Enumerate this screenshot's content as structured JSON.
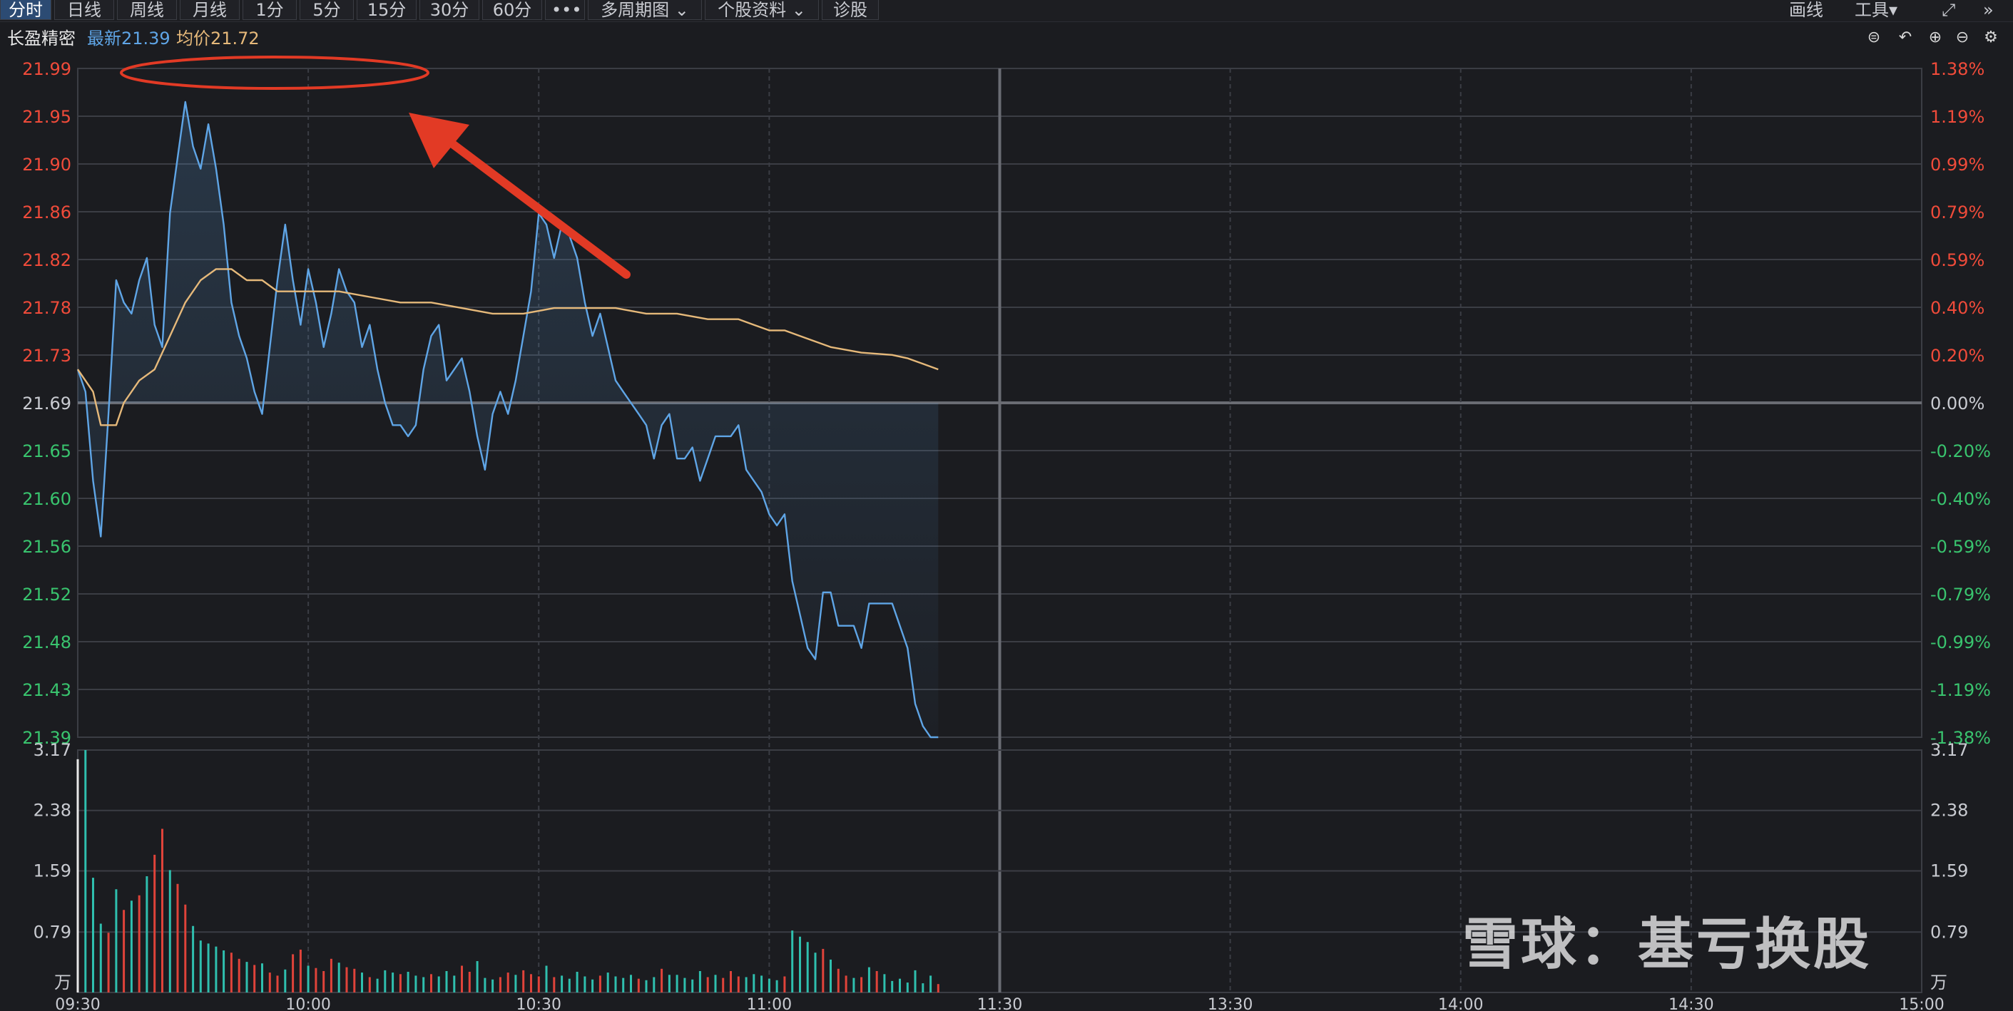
{
  "toolbar": {
    "tabs": [
      {
        "label": "分时",
        "active": true
      },
      {
        "label": "日线"
      },
      {
        "label": "周线"
      },
      {
        "label": "月线"
      },
      {
        "label": "1分"
      },
      {
        "label": "5分"
      },
      {
        "label": "15分"
      },
      {
        "label": "30分"
      },
      {
        "label": "60分"
      },
      {
        "label": "•••"
      },
      {
        "label": "多周期图 ⌄"
      },
      {
        "label": "个股资料 ⌄"
      },
      {
        "label": "诊股"
      }
    ],
    "draw_label": "画线",
    "tools_label": "工具▾",
    "fullscreen_icon": "⤢",
    "collapse_icon": "»"
  },
  "info": {
    "name": "长盈精密",
    "latest": "最新21.39",
    "avg": "均价21.72",
    "icons": [
      "reset-icon",
      "undo-icon",
      "zoom-in-icon",
      "zoom-out-icon",
      "gear-icon"
    ]
  },
  "colors": {
    "up": "#f04b3a",
    "down": "#39c46e",
    "price_line": "#5fa5e6",
    "avg_line": "#e6b97a",
    "vol_up": "#e0433a",
    "vol_down": "#2fbfae",
    "grid": "#3b3d44",
    "annotation": "#e23a25"
  },
  "watermark": "雪球：基亏换股",
  "chart_data": {
    "type": "line",
    "title": "",
    "price_axis": {
      "ylim": [
        21.39,
        21.99
      ],
      "ticks": [
        "21.99",
        "21.95",
        "21.90",
        "21.86",
        "21.82",
        "21.78",
        "21.73",
        "21.69",
        "21.65",
        "21.60",
        "21.56",
        "21.52",
        "21.48",
        "21.43",
        "21.39"
      ]
    },
    "pct_axis": {
      "ticks": [
        "1.38%",
        "1.19%",
        "0.99%",
        "0.79%",
        "0.59%",
        "0.40%",
        "0.20%",
        "0.00%",
        "-0.20%",
        "-0.40%",
        "-0.59%",
        "-0.79%",
        "-0.99%",
        "-1.19%",
        "-1.38%"
      ]
    },
    "prev_close": 21.69,
    "volume_axis": {
      "ylim": [
        0,
        3.17
      ],
      "ticks": [
        "3.17",
        "2.38",
        "1.59",
        "0.79"
      ],
      "unit": "万"
    },
    "x_ticks": [
      "09:30",
      "10:00",
      "10:30",
      "11:00",
      "11:30",
      "13:30",
      "14:00",
      "14:30",
      "15:00"
    ],
    "minutes_total": 240,
    "series": [
      {
        "name": "最新",
        "points": [
          [
            0,
            21.72
          ],
          [
            1,
            21.7
          ],
          [
            2,
            21.62
          ],
          [
            3,
            21.57
          ],
          [
            4,
            21.68
          ],
          [
            5,
            21.8
          ],
          [
            6,
            21.78
          ],
          [
            7,
            21.77
          ],
          [
            8,
            21.8
          ],
          [
            9,
            21.82
          ],
          [
            10,
            21.76
          ],
          [
            11,
            21.74
          ],
          [
            12,
            21.86
          ],
          [
            13,
            21.91
          ],
          [
            14,
            21.96
          ],
          [
            15,
            21.92
          ],
          [
            16,
            21.9
          ],
          [
            17,
            21.94
          ],
          [
            18,
            21.9
          ],
          [
            19,
            21.85
          ],
          [
            20,
            21.78
          ],
          [
            21,
            21.75
          ],
          [
            22,
            21.73
          ],
          [
            23,
            21.7
          ],
          [
            24,
            21.68
          ],
          [
            25,
            21.74
          ],
          [
            26,
            21.8
          ],
          [
            27,
            21.85
          ],
          [
            28,
            21.8
          ],
          [
            29,
            21.76
          ],
          [
            30,
            21.81
          ],
          [
            31,
            21.78
          ],
          [
            32,
            21.74
          ],
          [
            33,
            21.77
          ],
          [
            34,
            21.81
          ],
          [
            35,
            21.79
          ],
          [
            36,
            21.78
          ],
          [
            37,
            21.74
          ],
          [
            38,
            21.76
          ],
          [
            39,
            21.72
          ],
          [
            40,
            21.69
          ],
          [
            41,
            21.67
          ],
          [
            42,
            21.67
          ],
          [
            43,
            21.66
          ],
          [
            44,
            21.67
          ],
          [
            45,
            21.72
          ],
          [
            46,
            21.75
          ],
          [
            47,
            21.76
          ],
          [
            48,
            21.71
          ],
          [
            49,
            21.72
          ],
          [
            50,
            21.73
          ],
          [
            51,
            21.7
          ],
          [
            52,
            21.66
          ],
          [
            53,
            21.63
          ],
          [
            54,
            21.68
          ],
          [
            55,
            21.7
          ],
          [
            56,
            21.68
          ],
          [
            57,
            21.71
          ],
          [
            58,
            21.75
          ],
          [
            59,
            21.79
          ],
          [
            60,
            21.86
          ],
          [
            61,
            21.85
          ],
          [
            62,
            21.82
          ],
          [
            63,
            21.85
          ],
          [
            64,
            21.84
          ],
          [
            65,
            21.82
          ],
          [
            66,
            21.78
          ],
          [
            67,
            21.75
          ],
          [
            68,
            21.77
          ],
          [
            69,
            21.74
          ],
          [
            70,
            21.71
          ],
          [
            71,
            21.7
          ],
          [
            72,
            21.69
          ],
          [
            73,
            21.68
          ],
          [
            74,
            21.67
          ],
          [
            75,
            21.64
          ],
          [
            76,
            21.67
          ],
          [
            77,
            21.68
          ],
          [
            78,
            21.64
          ],
          [
            79,
            21.64
          ],
          [
            80,
            21.65
          ],
          [
            81,
            21.62
          ],
          [
            82,
            21.64
          ],
          [
            83,
            21.66
          ],
          [
            84,
            21.66
          ],
          [
            85,
            21.66
          ],
          [
            86,
            21.67
          ],
          [
            87,
            21.63
          ],
          [
            88,
            21.62
          ],
          [
            89,
            21.61
          ],
          [
            90,
            21.59
          ],
          [
            91,
            21.58
          ],
          [
            92,
            21.59
          ],
          [
            93,
            21.53
          ],
          [
            94,
            21.5
          ],
          [
            95,
            21.47
          ],
          [
            96,
            21.46
          ],
          [
            97,
            21.52
          ],
          [
            98,
            21.52
          ],
          [
            99,
            21.49
          ],
          [
            100,
            21.49
          ],
          [
            101,
            21.49
          ],
          [
            102,
            21.47
          ],
          [
            103,
            21.51
          ],
          [
            104,
            21.51
          ],
          [
            105,
            21.51
          ],
          [
            106,
            21.51
          ],
          [
            107,
            21.49
          ],
          [
            108,
            21.47
          ],
          [
            109,
            21.42
          ],
          [
            110,
            21.4
          ],
          [
            111,
            21.39
          ],
          [
            112,
            21.39
          ]
        ]
      },
      {
        "name": "均价",
        "points": [
          [
            0,
            21.72
          ],
          [
            2,
            21.7
          ],
          [
            3,
            21.67
          ],
          [
            4,
            21.67
          ],
          [
            5,
            21.67
          ],
          [
            6,
            21.69
          ],
          [
            8,
            21.71
          ],
          [
            10,
            21.72
          ],
          [
            12,
            21.75
          ],
          [
            14,
            21.78
          ],
          [
            16,
            21.8
          ],
          [
            18,
            21.81
          ],
          [
            20,
            21.81
          ],
          [
            22,
            21.8
          ],
          [
            24,
            21.8
          ],
          [
            26,
            21.79
          ],
          [
            30,
            21.79
          ],
          [
            34,
            21.79
          ],
          [
            38,
            21.785
          ],
          [
            42,
            21.78
          ],
          [
            46,
            21.78
          ],
          [
            50,
            21.775
          ],
          [
            54,
            21.77
          ],
          [
            58,
            21.77
          ],
          [
            62,
            21.775
          ],
          [
            66,
            21.775
          ],
          [
            70,
            21.775
          ],
          [
            74,
            21.77
          ],
          [
            78,
            21.77
          ],
          [
            82,
            21.765
          ],
          [
            86,
            21.765
          ],
          [
            88,
            21.76
          ],
          [
            90,
            21.755
          ],
          [
            92,
            21.755
          ],
          [
            94,
            21.75
          ],
          [
            96,
            21.745
          ],
          [
            98,
            21.74
          ],
          [
            102,
            21.735
          ],
          [
            106,
            21.733
          ],
          [
            108,
            21.73
          ],
          [
            110,
            21.725
          ],
          [
            112,
            21.72
          ]
        ]
      }
    ],
    "volume": [
      3.05,
      3.17,
      1.5,
      0.9,
      0.78,
      1.35,
      1.08,
      1.2,
      1.27,
      1.52,
      1.8,
      2.14,
      1.6,
      1.42,
      1.15,
      0.87,
      0.68,
      0.64,
      0.6,
      0.55,
      0.52,
      0.44,
      0.4,
      0.36,
      0.38,
      0.26,
      0.22,
      0.3,
      0.5,
      0.56,
      0.35,
      0.32,
      0.28,
      0.44,
      0.39,
      0.33,
      0.31,
      0.26,
      0.2,
      0.18,
      0.29,
      0.26,
      0.24,
      0.27,
      0.22,
      0.2,
      0.24,
      0.21,
      0.28,
      0.22,
      0.35,
      0.27,
      0.41,
      0.19,
      0.17,
      0.2,
      0.26,
      0.23,
      0.29,
      0.24,
      0.21,
      0.35,
      0.2,
      0.22,
      0.18,
      0.27,
      0.21,
      0.17,
      0.22,
      0.26,
      0.21,
      0.19,
      0.23,
      0.18,
      0.16,
      0.2,
      0.31,
      0.23,
      0.23,
      0.19,
      0.17,
      0.28,
      0.2,
      0.23,
      0.19,
      0.28,
      0.21,
      0.2,
      0.24,
      0.22,
      0.18,
      0.16,
      0.21,
      0.81,
      0.73,
      0.66,
      0.52,
      0.57,
      0.43,
      0.31,
      0.22,
      0.19,
      0.2,
      0.33,
      0.28,
      0.24,
      0.15,
      0.18,
      0.13,
      0.29,
      0.12,
      0.22,
      0.11
    ],
    "volume_dir": [
      "down",
      "down",
      "down",
      "down",
      "up",
      "down",
      "up",
      "down",
      "up",
      "down",
      "up",
      "up",
      "down",
      "up",
      "up",
      "down",
      "down",
      "down",
      "down",
      "down",
      "up",
      "up",
      "down",
      "up",
      "down",
      "up",
      "up",
      "down",
      "up",
      "up",
      "down",
      "up",
      "up",
      "up",
      "down",
      "up",
      "up",
      "down",
      "up",
      "down",
      "down",
      "down",
      "up",
      "down",
      "down",
      "down",
      "up",
      "down",
      "down",
      "down",
      "up",
      "up",
      "down",
      "down",
      "down",
      "up",
      "up",
      "down",
      "up",
      "up",
      "up",
      "down",
      "up",
      "down",
      "down",
      "down",
      "down",
      "down",
      "up",
      "down",
      "down",
      "down",
      "down",
      "up",
      "down",
      "down",
      "up",
      "down",
      "down",
      "down",
      "down",
      "down",
      "up",
      "down",
      "up",
      "up",
      "up",
      "down",
      "down",
      "down",
      "down",
      "down",
      "up",
      "down",
      "down",
      "down",
      "down",
      "up",
      "down",
      "up",
      "up",
      "down",
      "up",
      "down",
      "up",
      "down",
      "down",
      "down",
      "down",
      "down",
      "down",
      "down",
      "up"
    ]
  }
}
